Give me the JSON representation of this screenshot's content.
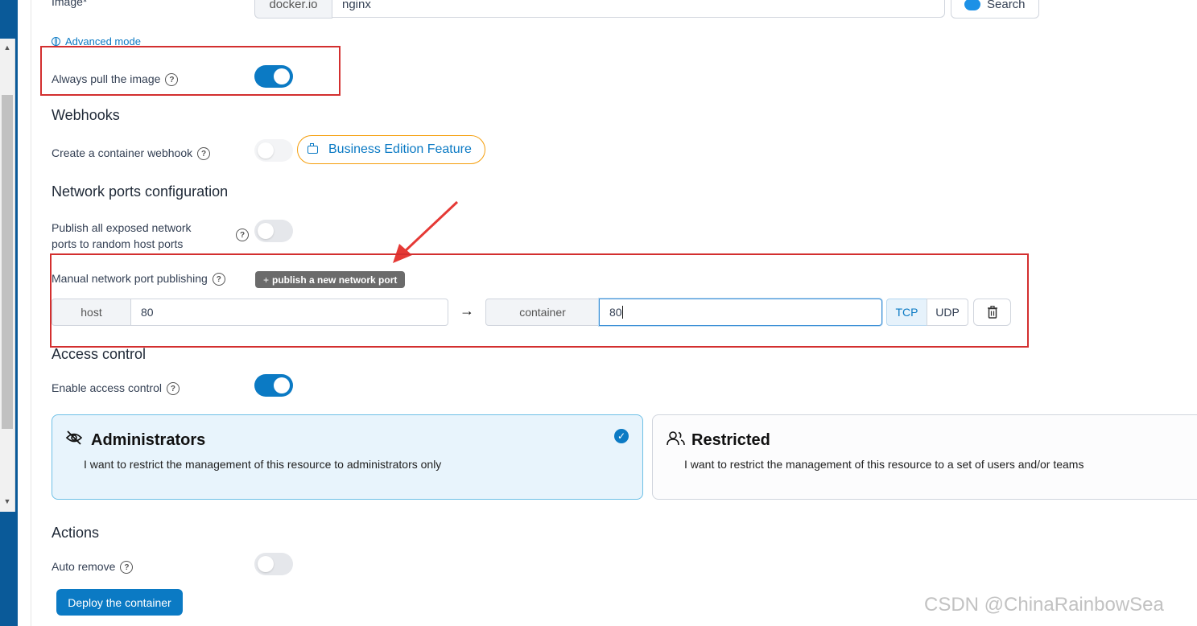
{
  "image": {
    "label": "Image*",
    "registry": "docker.io",
    "value": "nginx",
    "search_label": "Search"
  },
  "advanced_mode_label": "Advanced mode",
  "always_pull": {
    "label": "Always pull the image",
    "enabled": true
  },
  "webhooks": {
    "title": "Webhooks",
    "create_label": "Create a container webhook",
    "business_badge": "Business Edition Feature"
  },
  "network_ports": {
    "title": "Network ports configuration",
    "publish_all_label_line1": "Publish all exposed network",
    "publish_all_label_line2": "ports to random host ports",
    "manual_label": "Manual network port publishing",
    "publish_new_button": "publish a new network port",
    "mapping": {
      "host_label": "host",
      "host_value": "80",
      "container_label": "container",
      "container_value": "80",
      "arrow": "→",
      "tcp_label": "TCP",
      "udp_label": "UDP",
      "selected_protocol": "TCP"
    }
  },
  "access_control": {
    "title": "Access control",
    "enable_label": "Enable access control",
    "enabled": true,
    "options": [
      {
        "title": "Administrators",
        "desc": "I want to restrict the management of this resource to administrators only",
        "selected": true
      },
      {
        "title": "Restricted",
        "desc": "I want to restrict the management of this resource to a set of users and/or teams",
        "selected": false
      }
    ]
  },
  "actions": {
    "title": "Actions",
    "auto_remove_label": "Auto remove",
    "deploy_button": "Deploy the container"
  },
  "watermark": "CSDN @ChinaRainbowSea",
  "colors": {
    "accent": "#0b7ac4",
    "highlight_red": "#d32f2f",
    "badge_orange": "#f59e0b"
  }
}
